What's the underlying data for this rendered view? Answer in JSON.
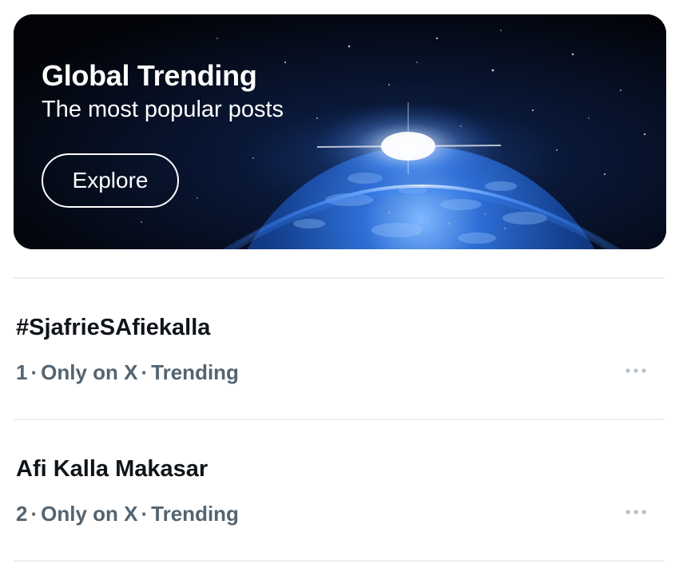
{
  "banner": {
    "title": "Global Trending",
    "subtitle": "The most popular posts",
    "explore_label": "Explore"
  },
  "trends": [
    {
      "rank": "1",
      "name": "#SjafrieSAfiekalla",
      "context": "Only on X",
      "status": "Trending"
    },
    {
      "rank": "2",
      "name": "Afi Kalla Makasar",
      "context": "Only on X",
      "status": "Trending"
    }
  ],
  "colors": {
    "text_primary": "#0f1419",
    "text_secondary": "#536471",
    "divider": "#eceef0",
    "banner_bg": "#03060d"
  },
  "icons": {
    "more": "more-horizontal-icon"
  }
}
